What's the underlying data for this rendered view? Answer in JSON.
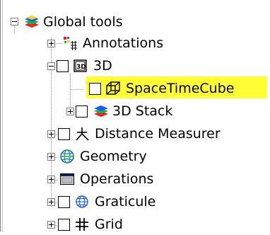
{
  "tree": {
    "root": {
      "label": "Global tools",
      "icon": "layers-icon",
      "expanded": true
    },
    "items": [
      {
        "label": "Annotations",
        "icon": "annotations-icon",
        "checkbox": false,
        "expanded": false
      },
      {
        "label": "3D",
        "icon": "3d-box-icon",
        "checkbox": true,
        "expanded": true
      },
      {
        "label": "SpaceTimeCube",
        "icon": "cube-icon",
        "checkbox": true,
        "highlighted": true
      },
      {
        "label": "3D Stack",
        "icon": "stack-layers-icon",
        "checkbox": true,
        "expanded": false
      },
      {
        "label": "Distance Measurer",
        "icon": "distance-measurer-icon",
        "checkbox": true,
        "expanded": false
      },
      {
        "label": "Geometry",
        "icon": "geometry-globe-icon",
        "checkbox": false,
        "expanded": false
      },
      {
        "label": "Operations",
        "icon": "operations-window-icon",
        "checkbox": false,
        "expanded": false
      },
      {
        "label": "Graticule",
        "icon": "graticule-globe-icon",
        "checkbox": true,
        "expanded": false
      },
      {
        "label": "Grid",
        "icon": "grid-hash-icon",
        "checkbox": true,
        "expanded": false
      }
    ]
  },
  "colors": {
    "highlight": "#ffff33",
    "tree_line": "#808080",
    "layer_green": "#16b43b",
    "layer_red": "#ff1616",
    "layer_blue": "#1a5cff",
    "layer_yellow": "#f5d21a"
  }
}
